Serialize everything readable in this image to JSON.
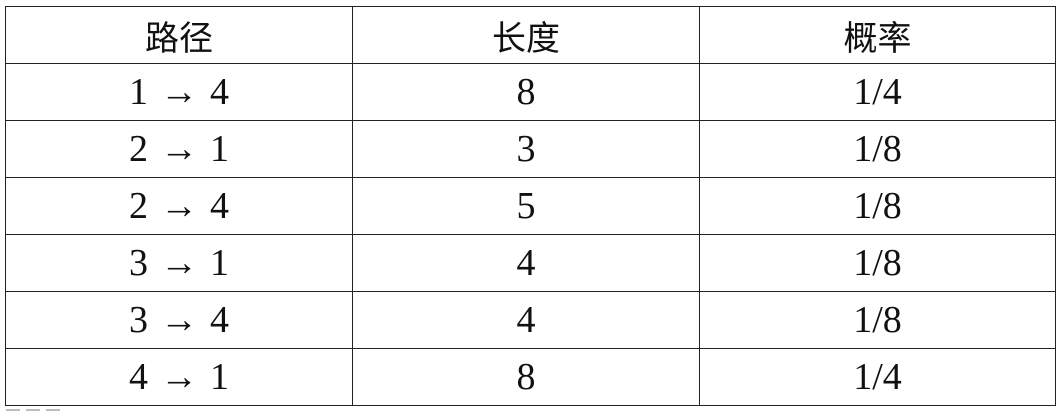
{
  "table": {
    "headers": [
      "路径",
      "长度",
      "概率"
    ],
    "rows": [
      {
        "from": "1",
        "arrow": "→",
        "to": "4",
        "length": "8",
        "probability": "1/4"
      },
      {
        "from": "2",
        "arrow": "→",
        "to": "1",
        "length": "3",
        "probability": "1/8"
      },
      {
        "from": "2",
        "arrow": "→",
        "to": "4",
        "length": "5",
        "probability": "1/8"
      },
      {
        "from": "3",
        "arrow": "→",
        "to": "1",
        "length": "4",
        "probability": "1/8"
      },
      {
        "from": "3",
        "arrow": "→",
        "to": "4",
        "length": "4",
        "probability": "1/8"
      },
      {
        "from": "4",
        "arrow": "→",
        "to": "1",
        "length": "8",
        "probability": "1/4"
      }
    ]
  }
}
